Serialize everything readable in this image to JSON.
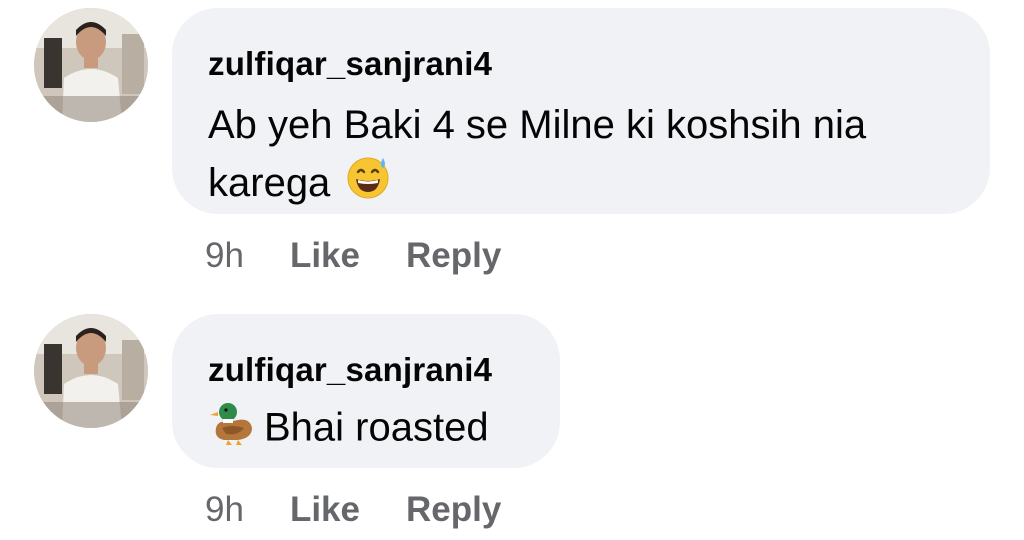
{
  "comments": [
    {
      "author": "zulfiqar_sanjrani4",
      "text_line1": "Ab yeh Baki 4 se Milne ki koshsih nia",
      "text_line2": "karega",
      "emoji": "grinning-face-with-sweat",
      "time": "9h",
      "like_label": "Like",
      "reply_label": "Reply"
    },
    {
      "author": "zulfiqar_sanjrani4",
      "text": "Bhai roasted",
      "emoji": "duck",
      "time": "9h",
      "like_label": "Like",
      "reply_label": "Reply"
    }
  ],
  "colors": {
    "bubble_background": "#f0f2f5",
    "text": "#050505",
    "secondary_text": "#65676b"
  }
}
